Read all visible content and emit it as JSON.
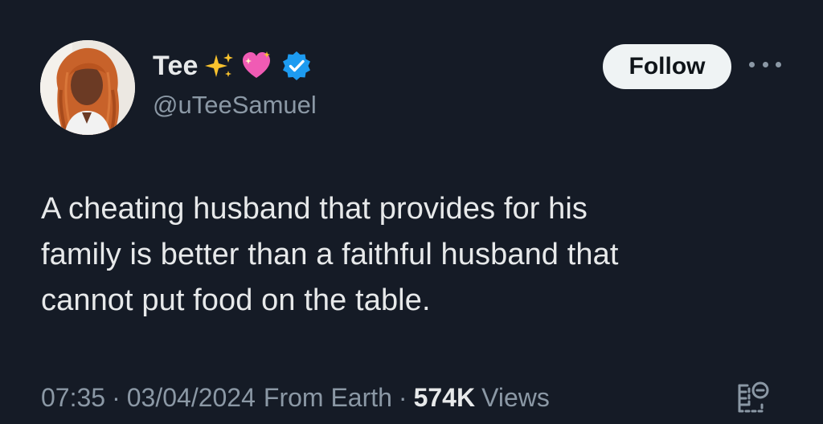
{
  "author": {
    "display_name": "Tee",
    "handle": "@uTeeSamuel",
    "emojis": [
      "sparkles-emoji",
      "sparkling-heart-emoji"
    ],
    "verified": true
  },
  "actions": {
    "follow_label": "Follow"
  },
  "tweet": {
    "lines": [
      "A cheating husband that provides for his",
      "family is better than a faithful husband that",
      "cannot put food on the table."
    ]
  },
  "meta": {
    "time": "07:35",
    "date": "03/04/2024",
    "source": "From Earth",
    "separator": "·",
    "views_count": "574K",
    "views_label": "Views"
  },
  "colors": {
    "background": "#151b26",
    "text_primary": "#e7e9ea",
    "text_secondary": "#8b98a5",
    "verified_blue": "#1d9bf0",
    "follow_bg": "#eff3f4"
  }
}
